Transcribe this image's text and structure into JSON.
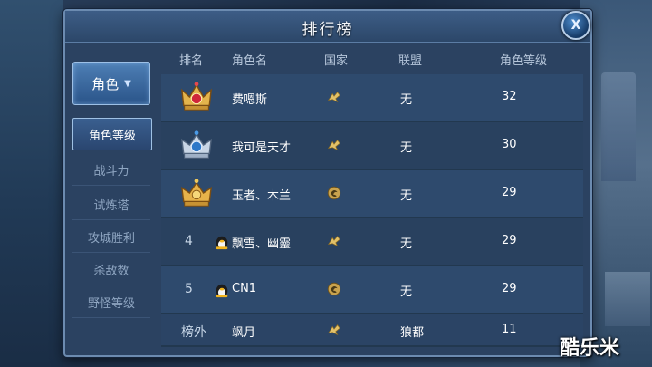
{
  "title": "排行榜",
  "close_label": "X",
  "nav": {
    "main_label": "角色",
    "items": [
      "角色等级",
      "战斗力",
      "试炼塔",
      "攻城胜利",
      "杀敌数",
      "野怪等级"
    ]
  },
  "table": {
    "headers": [
      "排名",
      "角色名",
      "国家",
      "联盟",
      "角色等级"
    ],
    "rows": [
      {
        "rank": "1",
        "name": "费嗯斯",
        "alliance": "无",
        "level": "32",
        "rank_icon": "red-crown-icon",
        "nation_icon": "bird-flag-icon"
      },
      {
        "rank": "2",
        "name": "我可是天才",
        "alliance": "无",
        "level": "30",
        "rank_icon": "blue-crown-icon",
        "nation_icon": "bird-flag-icon"
      },
      {
        "rank": "3",
        "name": "玉者、木兰",
        "alliance": "无",
        "level": "29",
        "rank_icon": "gold-crown-icon",
        "nation_icon": "dragon-emblem-icon"
      },
      {
        "rank": "4",
        "name": "飘雪、幽靈",
        "alliance": "无",
        "level": "29",
        "rank_icon": "",
        "nation_icon": "bird-flag-icon"
      },
      {
        "rank": "5",
        "name": "CN1",
        "alliance": "无",
        "level": "29",
        "rank_icon": "",
        "nation_icon": "dragon-emblem-icon"
      },
      {
        "rank": "榜外",
        "name": "飒月",
        "alliance": "狼都",
        "level": "11",
        "rank_icon": "",
        "nation_icon": "bird-flag-icon"
      }
    ]
  },
  "watermark": "酷乐米"
}
